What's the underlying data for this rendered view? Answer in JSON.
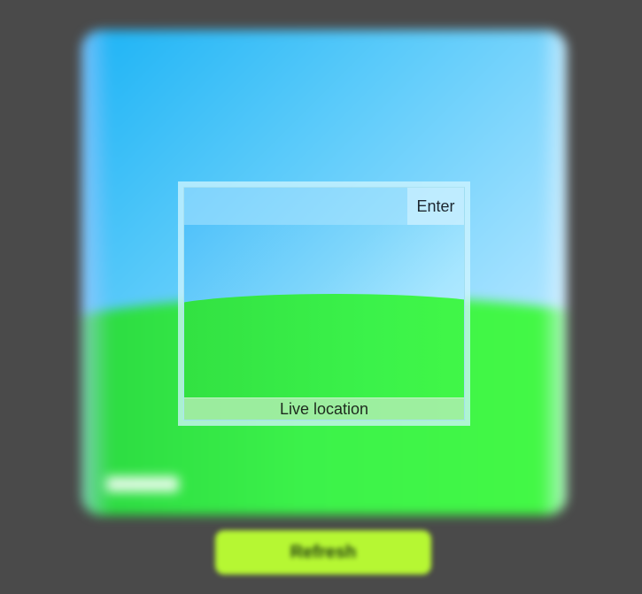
{
  "backdrop": {
    "refresh_label": "Refresh"
  },
  "live_panel": {
    "search": {
      "value": "",
      "placeholder": ""
    },
    "enter_label": "Enter",
    "caption": "Live location"
  },
  "colors": {
    "page_background": "#4a4a4a",
    "sky": "#1cb3f5",
    "grass": "#3cf24a",
    "refresh_button": "#b6f733",
    "caption_bar": "#b2eeb2"
  }
}
